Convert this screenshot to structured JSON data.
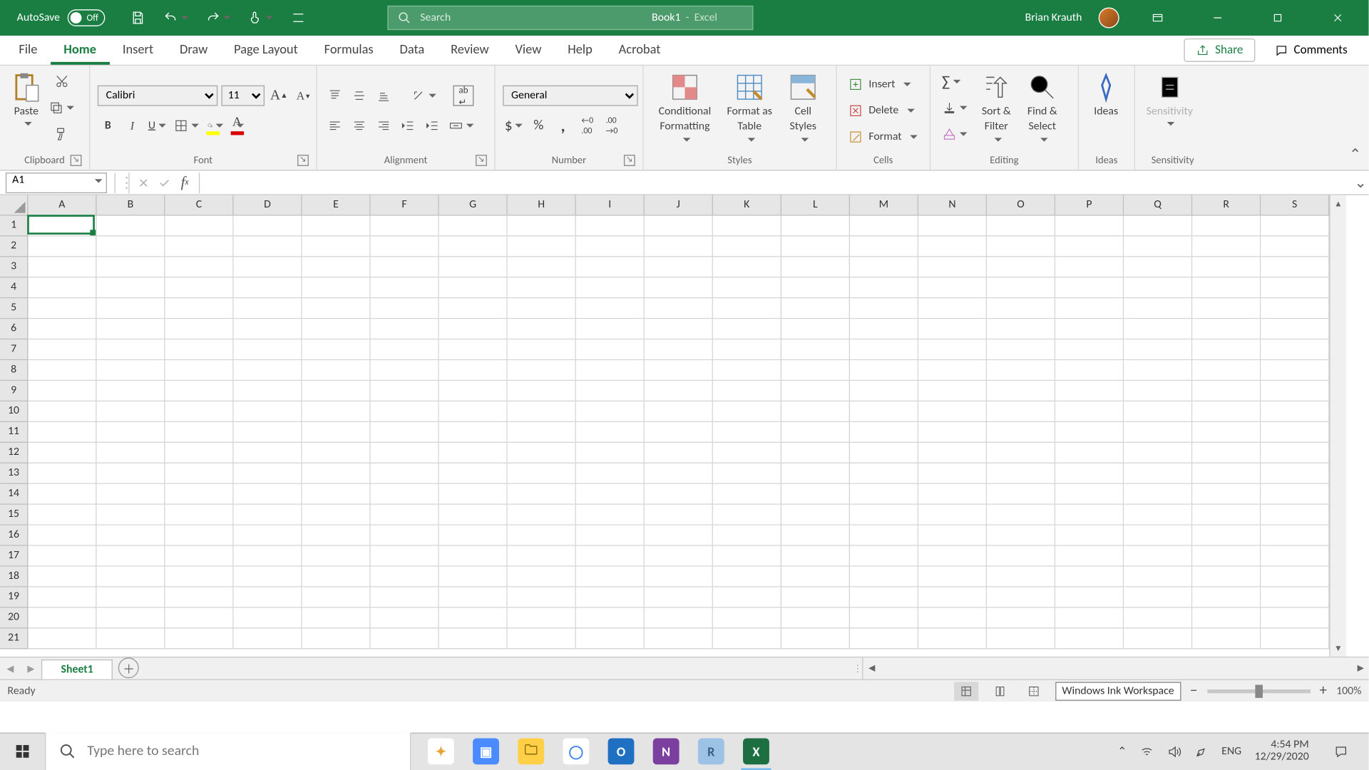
{
  "titlebar": {
    "autosave_label": "AutoSave",
    "autosave_state": "Off",
    "doc_name": "Book1",
    "app_name": "Excel",
    "search_placeholder": "Search",
    "user_name": "Brian Krauth"
  },
  "tabs": {
    "items": [
      "File",
      "Home",
      "Insert",
      "Draw",
      "Page Layout",
      "Formulas",
      "Data",
      "Review",
      "View",
      "Help",
      "Acrobat"
    ],
    "active_index": 1,
    "share": "Share",
    "comments": "Comments"
  },
  "ribbon": {
    "clipboard": {
      "paste": "Paste",
      "label": "Clipboard"
    },
    "font": {
      "name": "Calibri",
      "size": "11",
      "label": "Font"
    },
    "alignment": {
      "label": "Alignment"
    },
    "number": {
      "format": "General",
      "label": "Number"
    },
    "styles": {
      "cond": "Conditional Formatting",
      "cond_l1": "Conditional",
      "cond_l2": "Formatting",
      "fat_l1": "Format as",
      "fat_l2": "Table",
      "cell_l1": "Cell",
      "cell_l2": "Styles",
      "label": "Styles"
    },
    "cells": {
      "insert": "Insert",
      "delete": "Delete",
      "format": "Format",
      "label": "Cells"
    },
    "editing": {
      "sort_l1": "Sort &",
      "sort_l2": "Filter",
      "find_l1": "Find &",
      "find_l2": "Select",
      "label": "Editing"
    },
    "ideas": {
      "btn": "Ideas",
      "label": "Ideas"
    },
    "sensitivity": {
      "btn": "Sensitivity",
      "label": "Sensitivity"
    }
  },
  "fx": {
    "namebox": "A1",
    "formula": ""
  },
  "grid": {
    "cols": [
      "A",
      "B",
      "C",
      "D",
      "E",
      "F",
      "G",
      "H",
      "I",
      "J",
      "K",
      "L",
      "M",
      "N",
      "O",
      "P",
      "Q",
      "R",
      "S"
    ],
    "rows": [
      1,
      2,
      3,
      4,
      5,
      6,
      7,
      8,
      9,
      10,
      11,
      12,
      13,
      14,
      15,
      16,
      17,
      18,
      19,
      20,
      21
    ],
    "selected": "A1"
  },
  "sheets": {
    "active": "Sheet1"
  },
  "status": {
    "ready": "Ready",
    "tooltip": "Windows Ink Workspace",
    "zoom": "100%"
  },
  "taskbar": {
    "search_placeholder": "Type here to search",
    "lang": "ENG",
    "time": "4:54 PM",
    "date": "12/29/2020",
    "apps": [
      {
        "name": "google-photos",
        "bg": "#fff",
        "txt": "✦",
        "fg": "#e8a33d"
      },
      {
        "name": "zoom",
        "bg": "#4a8cff",
        "txt": "▣",
        "fg": "#fff"
      },
      {
        "name": "file-explorer",
        "bg": "#ffcf48",
        "txt": "🗀",
        "fg": "#7a5a00"
      },
      {
        "name": "chrome",
        "bg": "#fff",
        "txt": "◯",
        "fg": "#4285f4"
      },
      {
        "name": "outlook",
        "bg": "#1f6fc2",
        "txt": "O",
        "fg": "#fff"
      },
      {
        "name": "onenote",
        "bg": "#7b3fa0",
        "txt": "N",
        "fg": "#fff"
      },
      {
        "name": "rstudio",
        "bg": "#9cc2e5",
        "txt": "R",
        "fg": "#3a5f85"
      },
      {
        "name": "excel",
        "bg": "#1d6f42",
        "txt": "X",
        "fg": "#fff",
        "active": true
      }
    ]
  }
}
